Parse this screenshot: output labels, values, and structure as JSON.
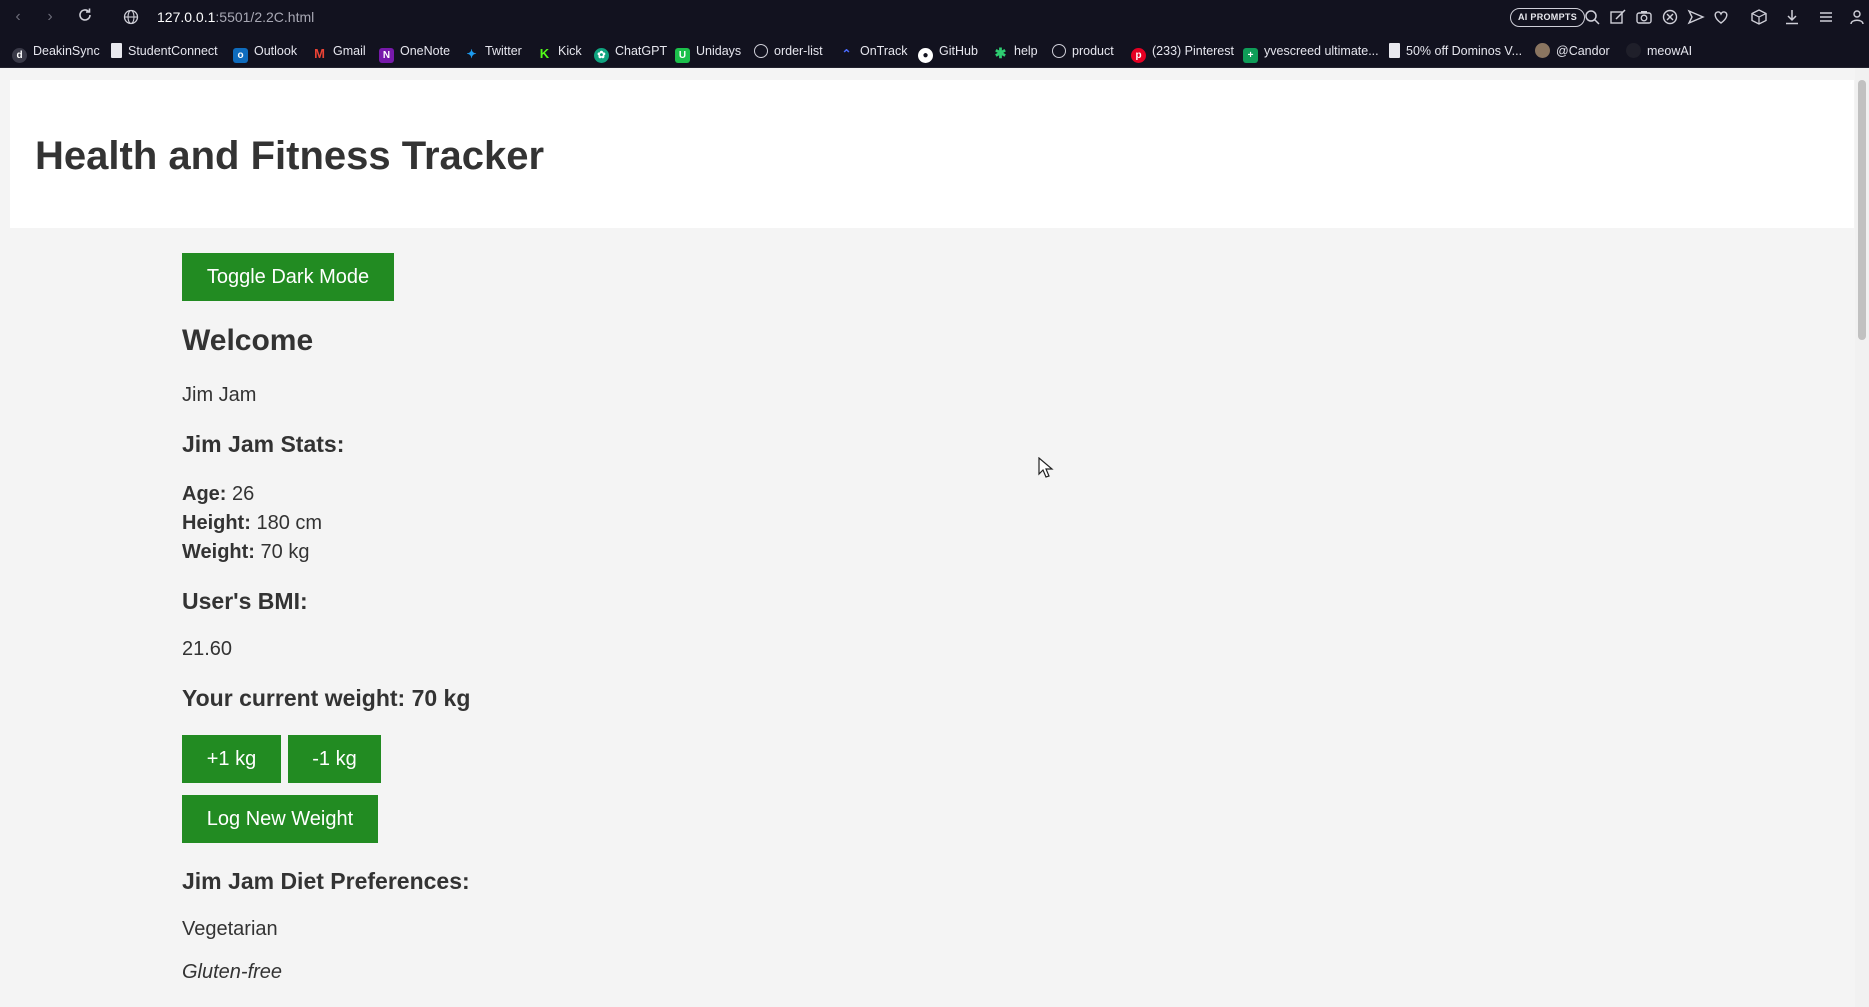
{
  "browser": {
    "url_host": "127.0.0.1",
    "url_path": ":5501/2.2C.html",
    "ai_prompts_label": "AI PROMPTS",
    "bookmarks": [
      {
        "label": "DeakinSync",
        "icon": "deakin-icon",
        "color": "#3a3a48"
      },
      {
        "label": "StudentConnect",
        "icon": "page-icon",
        "color": "#cfcfd8"
      },
      {
        "label": "Outlook",
        "icon": "outlook-icon",
        "color": "#0f6cbd"
      },
      {
        "label": "Gmail",
        "icon": "gmail-icon",
        "color": "#ea4335"
      },
      {
        "label": "OneNote",
        "icon": "onenote-icon",
        "color": "#7719aa"
      },
      {
        "label": "Twitter",
        "icon": "twitter-icon",
        "color": "#1d9bf0"
      },
      {
        "label": "Kick",
        "icon": "kick-icon",
        "color": "#53fc18"
      },
      {
        "label": "ChatGPT",
        "icon": "chatgpt-icon",
        "color": "#10a37f"
      },
      {
        "label": "Unidays",
        "icon": "unidays-icon",
        "color": "#1cc04b"
      },
      {
        "label": "order-list",
        "icon": "globe-icon",
        "color": "#cfcfd8"
      },
      {
        "label": "OnTrack",
        "icon": "ontrack-icon",
        "color": "#4b6bff"
      },
      {
        "label": "GitHub",
        "icon": "github-icon",
        "color": "#ffffff"
      },
      {
        "label": "help",
        "icon": "star-icon",
        "color": "#2ecc71"
      },
      {
        "label": "product",
        "icon": "globe-icon",
        "color": "#cfcfd8"
      },
      {
        "label": "(233) Pinterest",
        "icon": "pinterest-icon",
        "color": "#e60023"
      },
      {
        "label": "yvescreed ultimate...",
        "icon": "sheets-icon",
        "color": "#0f9d58"
      },
      {
        "label": "50% off Dominos V...",
        "icon": "page-icon",
        "color": "#cfcfd8"
      },
      {
        "label": "@Candor",
        "icon": "avatar-icon",
        "color": "#8a7560"
      },
      {
        "label": "meowAI",
        "icon": "meow-icon",
        "color": "#1f1f2a"
      }
    ]
  },
  "header": {
    "title": "Health and Fitness Tracker"
  },
  "main": {
    "toggle_label": "Toggle Dark Mode",
    "welcome_heading": "Welcome",
    "user_name": "Jim Jam",
    "stats_heading": "Jim Jam Stats:",
    "stats": {
      "age_label": "Age:",
      "age_value": "26",
      "height_label": "Height:",
      "height_value": "180 cm",
      "weight_label": "Weight:",
      "weight_value": "70 kg"
    },
    "bmi_heading": "User's BMI:",
    "bmi_value": "21.60",
    "current_weight_heading": "Your current weight: 70 kg",
    "plus_label": "+1 kg",
    "minus_label": "-1 kg",
    "log_label": "Log New Weight",
    "diet_heading": "Jim Jam Diet Preferences:",
    "diet_items": [
      "Vegetarian",
      "Gluten-free"
    ]
  },
  "colors": {
    "accent_button": "#228b22",
    "page_bg": "#f4f4f4",
    "chrome_bg": "#12121f"
  }
}
